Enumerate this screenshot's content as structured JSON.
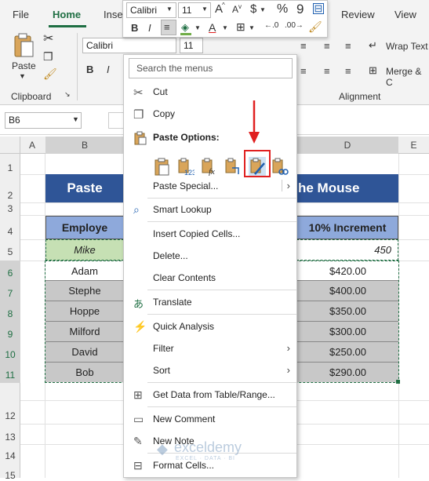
{
  "tabs": [
    "File",
    "Home",
    "Inse",
    "Review",
    "View"
  ],
  "ribbon": {
    "paste": "Paste",
    "clipboard": "Clipboard",
    "font_name": "Calibri",
    "font_size": "11",
    "wrap_text": "Wrap Text",
    "merge": "Merge & C",
    "alignment": "Alignment",
    "bold": "B",
    "italic": "I"
  },
  "mini_toolbar": {
    "font_name": "Calibri",
    "font_size": "11",
    "grow": "A",
    "shrink": "A",
    "currency": "$",
    "percent": "%",
    "comma": "9",
    "bold": "B",
    "italic": "I",
    "font_color_letter": "A"
  },
  "name_box": "B6",
  "columns": [
    "A",
    "B",
    "D",
    "E"
  ],
  "rows": [
    "1",
    "2",
    "3",
    "4",
    "5",
    "6",
    "7",
    "8",
    "9",
    "10",
    "11",
    "12",
    "13",
    "14",
    "15"
  ],
  "sheet": {
    "title_left": "Paste",
    "title_right": "he Mouse",
    "header_left": "Employe",
    "header_right": "10% Increment",
    "row5_left": "Mike",
    "row5_right": "450",
    "names": [
      "Adam",
      "Stephe",
      "Hoppe",
      "Milford",
      "David",
      "Bob"
    ],
    "increments": [
      "$420.00",
      "$400.00",
      "$350.00",
      "$300.00",
      "$250.00",
      "$290.00"
    ]
  },
  "search_placeholder": "Search the menus",
  "menu": {
    "cut": "Cut",
    "copy": "Copy",
    "paste_options": "Paste Options:",
    "paste_special": "Paste Special...",
    "smart_lookup": "Smart Lookup",
    "insert_copied": "Insert Copied Cells...",
    "delete": "Delete...",
    "clear_contents": "Clear Contents",
    "translate": "Translate",
    "quick_analysis": "Quick Analysis",
    "filter": "Filter",
    "sort": "Sort",
    "get_data": "Get Data from Table/Range...",
    "new_comment": "New Comment",
    "new_note": "New Note",
    "format_cells": "Format Cells..."
  },
  "watermark": {
    "name": "exceldemy",
    "tagline": "EXCEL · DATA · BI"
  },
  "colors": {
    "accent": "#1e6e42",
    "title_blue": "#2f5597",
    "header_blue": "#8ea9db",
    "mike_green": "#c6e0b4",
    "gray_fill": "#c8c8c8",
    "highlight_red": "#e02020"
  }
}
